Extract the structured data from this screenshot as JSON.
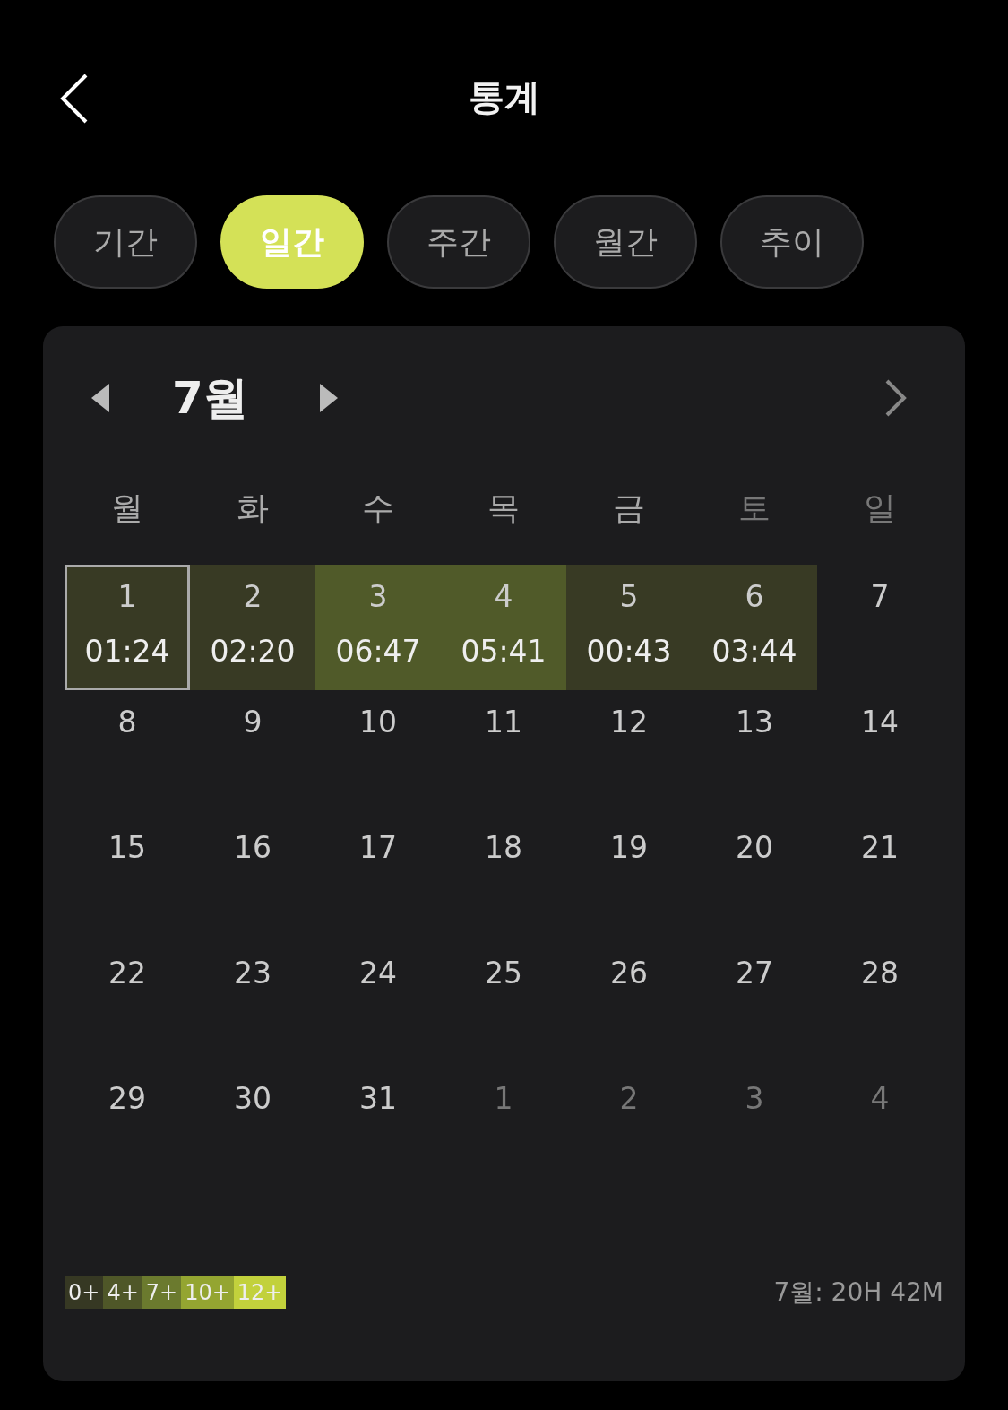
{
  "header": {
    "title": "통계"
  },
  "tabs": [
    {
      "label": "기간",
      "selected": false
    },
    {
      "label": "일간",
      "selected": true
    },
    {
      "label": "주간",
      "selected": false
    },
    {
      "label": "월간",
      "selected": false
    },
    {
      "label": "추이",
      "selected": false
    }
  ],
  "calendar": {
    "month": "7월",
    "weekdays": [
      {
        "label": "월",
        "dim": false
      },
      {
        "label": "화",
        "dim": false
      },
      {
        "label": "수",
        "dim": false
      },
      {
        "label": "목",
        "dim": false
      },
      {
        "label": "금",
        "dim": false
      },
      {
        "label": "토",
        "dim": true
      },
      {
        "label": "일",
        "dim": true
      }
    ],
    "days": [
      {
        "day": "1",
        "time": "01:24",
        "color": "#383a24",
        "selected": true,
        "dim": false
      },
      {
        "day": "2",
        "time": "02:20",
        "color": "#383a24",
        "selected": false,
        "dim": false
      },
      {
        "day": "3",
        "time": "06:47",
        "color": "#505a29",
        "selected": false,
        "dim": false
      },
      {
        "day": "4",
        "time": "05:41",
        "color": "#505a29",
        "selected": false,
        "dim": false
      },
      {
        "day": "5",
        "time": "00:43",
        "color": "#383a24",
        "selected": false,
        "dim": false
      },
      {
        "day": "6",
        "time": "03:44",
        "color": "#383a24",
        "selected": false,
        "dim": false
      },
      {
        "day": "7",
        "selected": false,
        "dim": false
      },
      {
        "day": "8",
        "selected": false,
        "dim": false
      },
      {
        "day": "9",
        "selected": false,
        "dim": false
      },
      {
        "day": "10",
        "selected": false,
        "dim": false
      },
      {
        "day": "11",
        "selected": false,
        "dim": false
      },
      {
        "day": "12",
        "selected": false,
        "dim": false
      },
      {
        "day": "13",
        "selected": false,
        "dim": false
      },
      {
        "day": "14",
        "selected": false,
        "dim": false
      },
      {
        "day": "15",
        "selected": false,
        "dim": false
      },
      {
        "day": "16",
        "selected": false,
        "dim": false
      },
      {
        "day": "17",
        "selected": false,
        "dim": false
      },
      {
        "day": "18",
        "selected": false,
        "dim": false
      },
      {
        "day": "19",
        "selected": false,
        "dim": false
      },
      {
        "day": "20",
        "selected": false,
        "dim": false
      },
      {
        "day": "21",
        "selected": false,
        "dim": false
      },
      {
        "day": "22",
        "selected": false,
        "dim": false
      },
      {
        "day": "23",
        "selected": false,
        "dim": false
      },
      {
        "day": "24",
        "selected": false,
        "dim": false
      },
      {
        "day": "25",
        "selected": false,
        "dim": false
      },
      {
        "day": "26",
        "selected": false,
        "dim": false
      },
      {
        "day": "27",
        "selected": false,
        "dim": false
      },
      {
        "day": "28",
        "selected": false,
        "dim": false
      },
      {
        "day": "29",
        "selected": false,
        "dim": false
      },
      {
        "day": "30",
        "selected": false,
        "dim": false
      },
      {
        "day": "31",
        "selected": false,
        "dim": false
      },
      {
        "day": "1",
        "selected": false,
        "dim": true
      },
      {
        "day": "2",
        "selected": false,
        "dim": true
      },
      {
        "day": "3",
        "selected": false,
        "dim": true
      },
      {
        "day": "4",
        "selected": false,
        "dim": true
      }
    ],
    "legend": [
      {
        "label": "0+",
        "color": "#363823"
      },
      {
        "label": "4+",
        "color": "#4f5728"
      },
      {
        "label": "7+",
        "color": "#6b7a2e"
      },
      {
        "label": "10+",
        "color": "#94a531"
      },
      {
        "label": "12+",
        "color": "#c2d13c"
      }
    ],
    "total": "7월: 20H 42M"
  }
}
